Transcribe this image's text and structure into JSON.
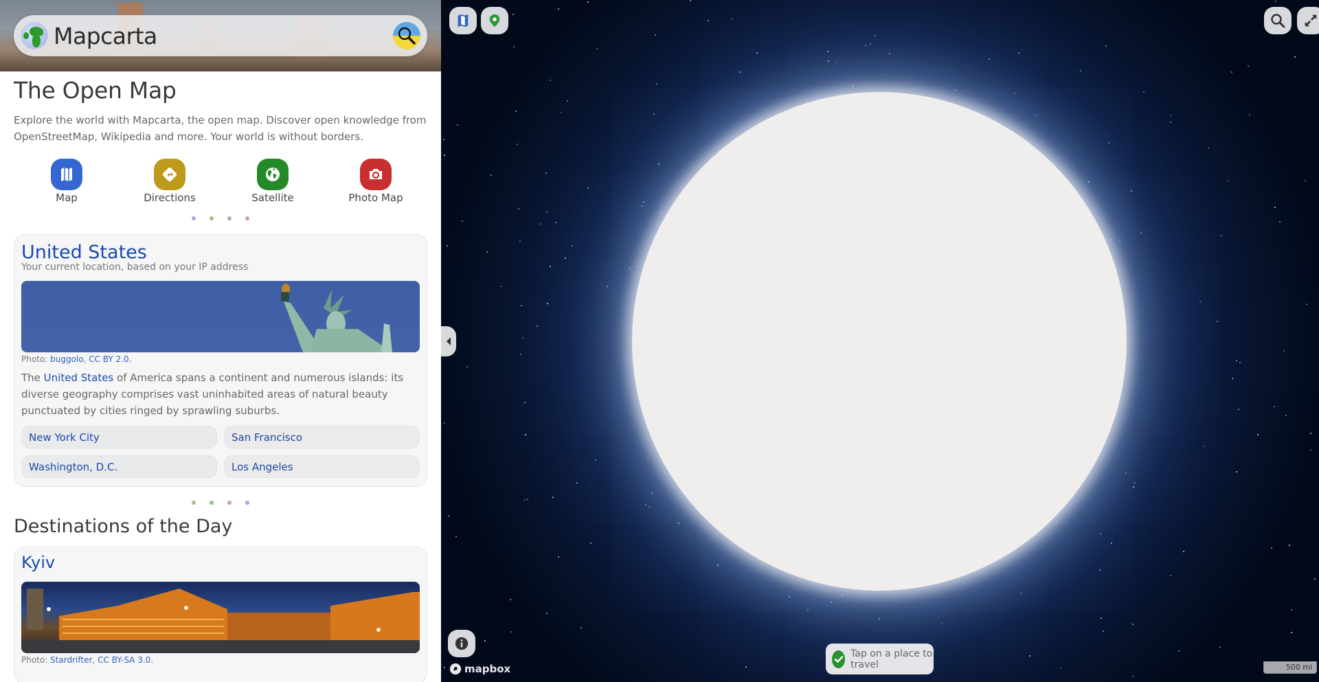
{
  "app": {
    "brand": "Mapcarta",
    "colors": {
      "accent_blue": "#1a4aa8",
      "map_btn": "#3467d1",
      "directions_btn": "#bd9a1c",
      "satellite_btn": "#238a27",
      "photo_btn": "#c8302f"
    }
  },
  "header": {
    "brand_label": "Mapcarta",
    "logo_icon": "globe-icon",
    "search_icon": "search-icon"
  },
  "intro": {
    "title": "The Open Map",
    "text": "Explore the world with Mapcarta, the open map. Discover open knowledge from OpenStreetMap, Wikipedia and more. Your world is without borders."
  },
  "quick_links": [
    {
      "label": "Map",
      "icon": "map-icon",
      "color": "#3467d1"
    },
    {
      "label": "Directions",
      "icon": "directions-icon",
      "color": "#bd9a1c"
    },
    {
      "label": "Satellite",
      "icon": "globe-icon",
      "color": "#238a27"
    },
    {
      "label": "Photo Map",
      "icon": "camera-icon",
      "color": "#c8302f"
    }
  ],
  "pager_dots_top": [
    "#a2acd3",
    "#bbb08a",
    "#9cb59c",
    "#c4a4b0"
  ],
  "pager_dots_mid": [
    "#b2bb88",
    "#8fbf8f",
    "#c4a4b0",
    "#a2acd3"
  ],
  "location_card": {
    "title": "United States",
    "subtitle": "Your current location, based on your IP address",
    "photo_credit_prefix": "Photo: ",
    "photo_author": "buggolo",
    "photo_license": "CC BY 2.0",
    "desc_prefix": "The ",
    "desc_link": "United States",
    "desc_rest": " of America spans a continent and numerous islands: its diverse geography comprises vast uninhabited areas of natural beauty punctuated by cities ringed by sprawling suburbs.",
    "cities": [
      "New York City",
      "San Francisco",
      "Washington, D.C.",
      "Los Angeles"
    ]
  },
  "destinations": {
    "heading": "Destinations of the Day",
    "card_title": "Kyiv",
    "photo_credit_prefix": "Photo: ",
    "photo_author": "Stardrifter",
    "photo_license": "CC BY-SA 3.0"
  },
  "map": {
    "attribution": "mapbox",
    "toast": "Tap on a place to travel",
    "scale": "500 mi",
    "buttons": [
      "map-layers",
      "location",
      "search",
      "fullscreen",
      "info",
      "collapse-sidebar"
    ]
  }
}
